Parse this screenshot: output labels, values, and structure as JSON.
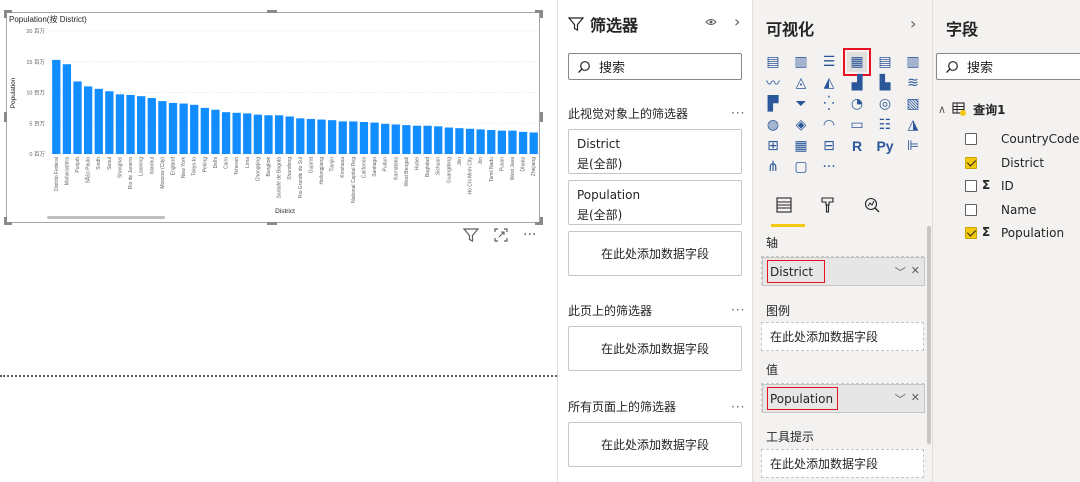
{
  "canvas": {
    "visual_tools": [
      "filter-icon",
      "focus-mode-icon",
      "more-options-icon"
    ],
    "more_label": "···"
  },
  "chart_data": {
    "type": "bar",
    "title": "Population(按 District)",
    "xlabel": "District",
    "ylabel": "Population",
    "ylim": [
      0,
      20
    ],
    "yticks": [
      "0 百万",
      "5 百万",
      "10 百万",
      "15 百万",
      "20 百万"
    ],
    "yticks_values": [
      0,
      5,
      10,
      15,
      20
    ],
    "grid": true,
    "bar_color": "#118dff",
    "categories": [
      "Distrito Federal",
      "Maharashtra",
      "Punjab",
      "SÃ£o Paulo",
      "Sindh",
      "Seoul",
      "Shanghai",
      "Rio de Janeiro",
      "Liaoning",
      "Istanbul",
      "Moscow (City)",
      "England",
      "New York",
      "Tokyo-to",
      "Peking",
      "Delhi",
      "Cairo",
      "Teheran",
      "Lima",
      "Chongqing",
      "Bangkok",
      "Santafé de Bogotá",
      "Shandong",
      "Rio Grande do Sul",
      "Gujarat",
      "Heilongjiang",
      "Tianjin",
      "Kinshasa",
      "National Capital Reg",
      "California",
      "Santiago",
      "Pudun",
      "Karnataka",
      "West Bengali",
      "Hubei",
      "Baghdad",
      "Sichuan",
      "Guangdong",
      "Jilin",
      "Ho Chi Minh City",
      "Jiin",
      "Tamil Nadu",
      "Pusan",
      "West Java",
      "Dhaka",
      "Zhejiang"
    ],
    "values": [
      15.3,
      14.6,
      11.8,
      11.0,
      10.6,
      10.2,
      9.7,
      9.6,
      9.4,
      9.1,
      8.6,
      8.3,
      8.2,
      8.0,
      7.5,
      7.2,
      6.8,
      6.7,
      6.6,
      6.4,
      6.3,
      6.3,
      6.1,
      5.8,
      5.7,
      5.6,
      5.5,
      5.3,
      5.3,
      5.2,
      5.1,
      4.9,
      4.8,
      4.7,
      4.6,
      4.6,
      4.5,
      4.3,
      4.2,
      4.1,
      4.0,
      3.9,
      3.8,
      3.8,
      3.6,
      3.5
    ]
  },
  "filters": {
    "title": "筛选器",
    "search_placeholder": "搜索",
    "visual_section": "此视觉对象上的筛选器",
    "more": "···",
    "cards": [
      {
        "field": "District",
        "state": "是(全部)"
      },
      {
        "field": "Population",
        "state": "是(全部)"
      }
    ],
    "add_field": "在此处添加数据字段",
    "page_section": "此页上的筛选器",
    "all_pages_section": "所有页面上的筛选器"
  },
  "viz": {
    "title": "可视化",
    "selected_icon": "clustered-column-chart-icon",
    "more_visuals": "···",
    "wells": {
      "axis_title": "轴",
      "axis_value": "District",
      "legend_title": "图例",
      "legend_placeholder": "在此处添加数据字段",
      "values_title": "值",
      "values_value": "Population",
      "tooltips_title": "工具提示",
      "tooltips_placeholder": "在此处添加数据字段"
    },
    "tab_icons": [
      "fields-tab-icon",
      "format-tab-icon",
      "analytics-tab-icon"
    ]
  },
  "fields": {
    "title": "字段",
    "search_placeholder": "搜索",
    "table_name": "查询1",
    "items": [
      {
        "name": "CountryCode",
        "checked": false,
        "sigma": false
      },
      {
        "name": "District",
        "checked": true,
        "sigma": false
      },
      {
        "name": "ID",
        "checked": false,
        "sigma": true
      },
      {
        "name": "Name",
        "checked": false,
        "sigma": false
      },
      {
        "name": "Population",
        "checked": true,
        "sigma": true
      }
    ]
  }
}
